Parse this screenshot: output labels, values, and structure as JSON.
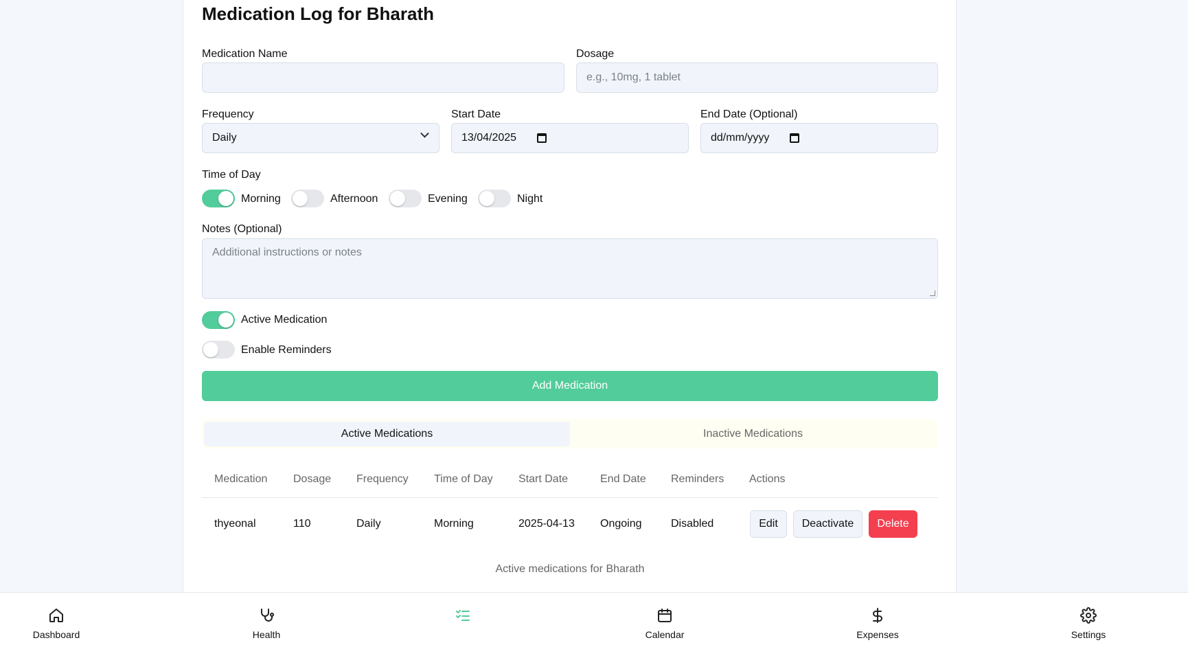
{
  "form": {
    "title": "Medication Log for Bharath",
    "medication_name_label": "Medication Name",
    "medication_name_value": "",
    "dosage_label": "Dosage",
    "dosage_placeholder": "e.g., 10mg, 1 tablet",
    "frequency_label": "Frequency",
    "frequency_value": "Daily",
    "start_date_label": "Start Date",
    "start_date_value": "13/04/2025",
    "end_date_label": "End Date (Optional)",
    "end_date_placeholder": "dd/mm/yyyy",
    "time_of_day_label": "Time of Day",
    "time_options": [
      {
        "label": "Morning",
        "on": true
      },
      {
        "label": "Afternoon",
        "on": false
      },
      {
        "label": "Evening",
        "on": false
      },
      {
        "label": "Night",
        "on": false
      }
    ],
    "notes_label": "Notes (Optional)",
    "notes_placeholder": "Additional instructions or notes",
    "active_label": "Active Medication",
    "active_on": true,
    "reminders_label": "Enable Reminders",
    "reminders_on": false,
    "add_button": "Add Medication"
  },
  "tabs": {
    "active": "Active Medications",
    "inactive": "Inactive Medications"
  },
  "table": {
    "headers": [
      "Medication",
      "Dosage",
      "Frequency",
      "Time of Day",
      "Start Date",
      "End Date",
      "Reminders",
      "Actions"
    ],
    "rows": [
      {
        "medication": "thyeonal",
        "dosage": "110",
        "frequency": "Daily",
        "time_of_day": "Morning",
        "start_date": "2025-04-13",
        "end_date": "Ongoing",
        "reminders": "Disabled",
        "actions": {
          "edit": "Edit",
          "deactivate": "Deactivate",
          "delete": "Delete"
        }
      }
    ],
    "caption": "Active medications for Bharath"
  },
  "nav": {
    "items": [
      {
        "label": "Dashboard",
        "icon": "home-icon"
      },
      {
        "label": "Health",
        "icon": "stethoscope-icon"
      },
      {
        "label": "",
        "icon": "checklist-icon",
        "active": true
      },
      {
        "label": "Calendar",
        "icon": "calendar-icon"
      },
      {
        "label": "Expenses",
        "icon": "dollar-icon"
      },
      {
        "label": "Settings",
        "icon": "gear-icon"
      }
    ]
  },
  "colors": {
    "accent": "#52cc9a",
    "danger": "#f43f4f",
    "background": "#f4f7fc"
  }
}
